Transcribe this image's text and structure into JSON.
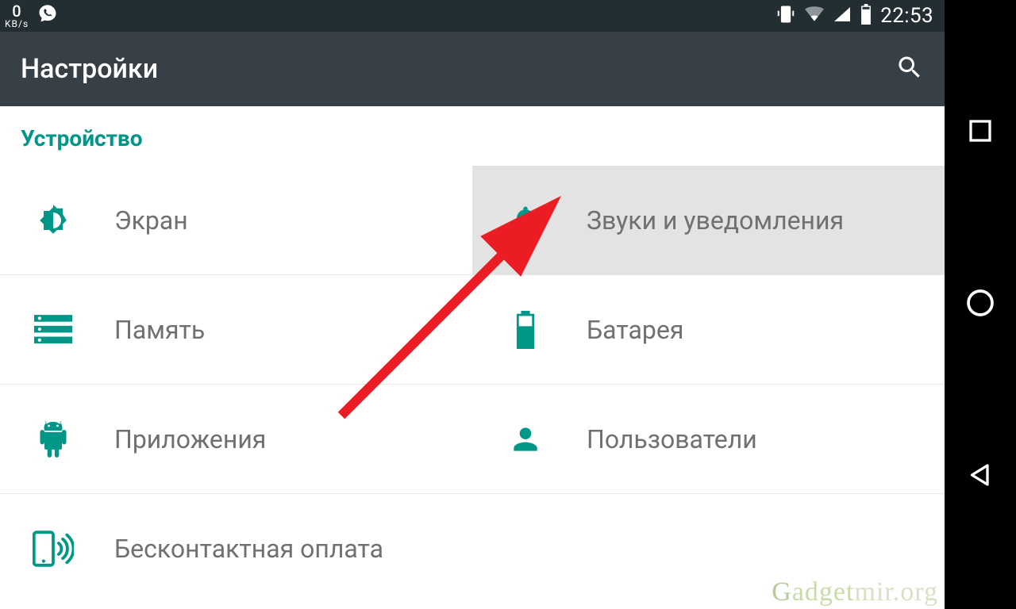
{
  "statusbar": {
    "speed_value": "0",
    "speed_unit": "KB/s",
    "clock": "22:53"
  },
  "header": {
    "title": "Настройки"
  },
  "section": {
    "title": "Устройство"
  },
  "items": {
    "display": "Экран",
    "sound": "Звуки и уведомления",
    "memory": "Память",
    "battery": "Батарея",
    "apps": "Приложения",
    "users": "Пользователи",
    "nfc": "Бесконтактная оплата"
  },
  "watermark": "Gadgetmir.org",
  "colors": {
    "accent": "#009688",
    "header_bg": "#364046",
    "status_bg": "#232e32",
    "text_muted": "#707070",
    "highlight_bg": "#e3e3e3",
    "arrow": "#ec1c24"
  }
}
